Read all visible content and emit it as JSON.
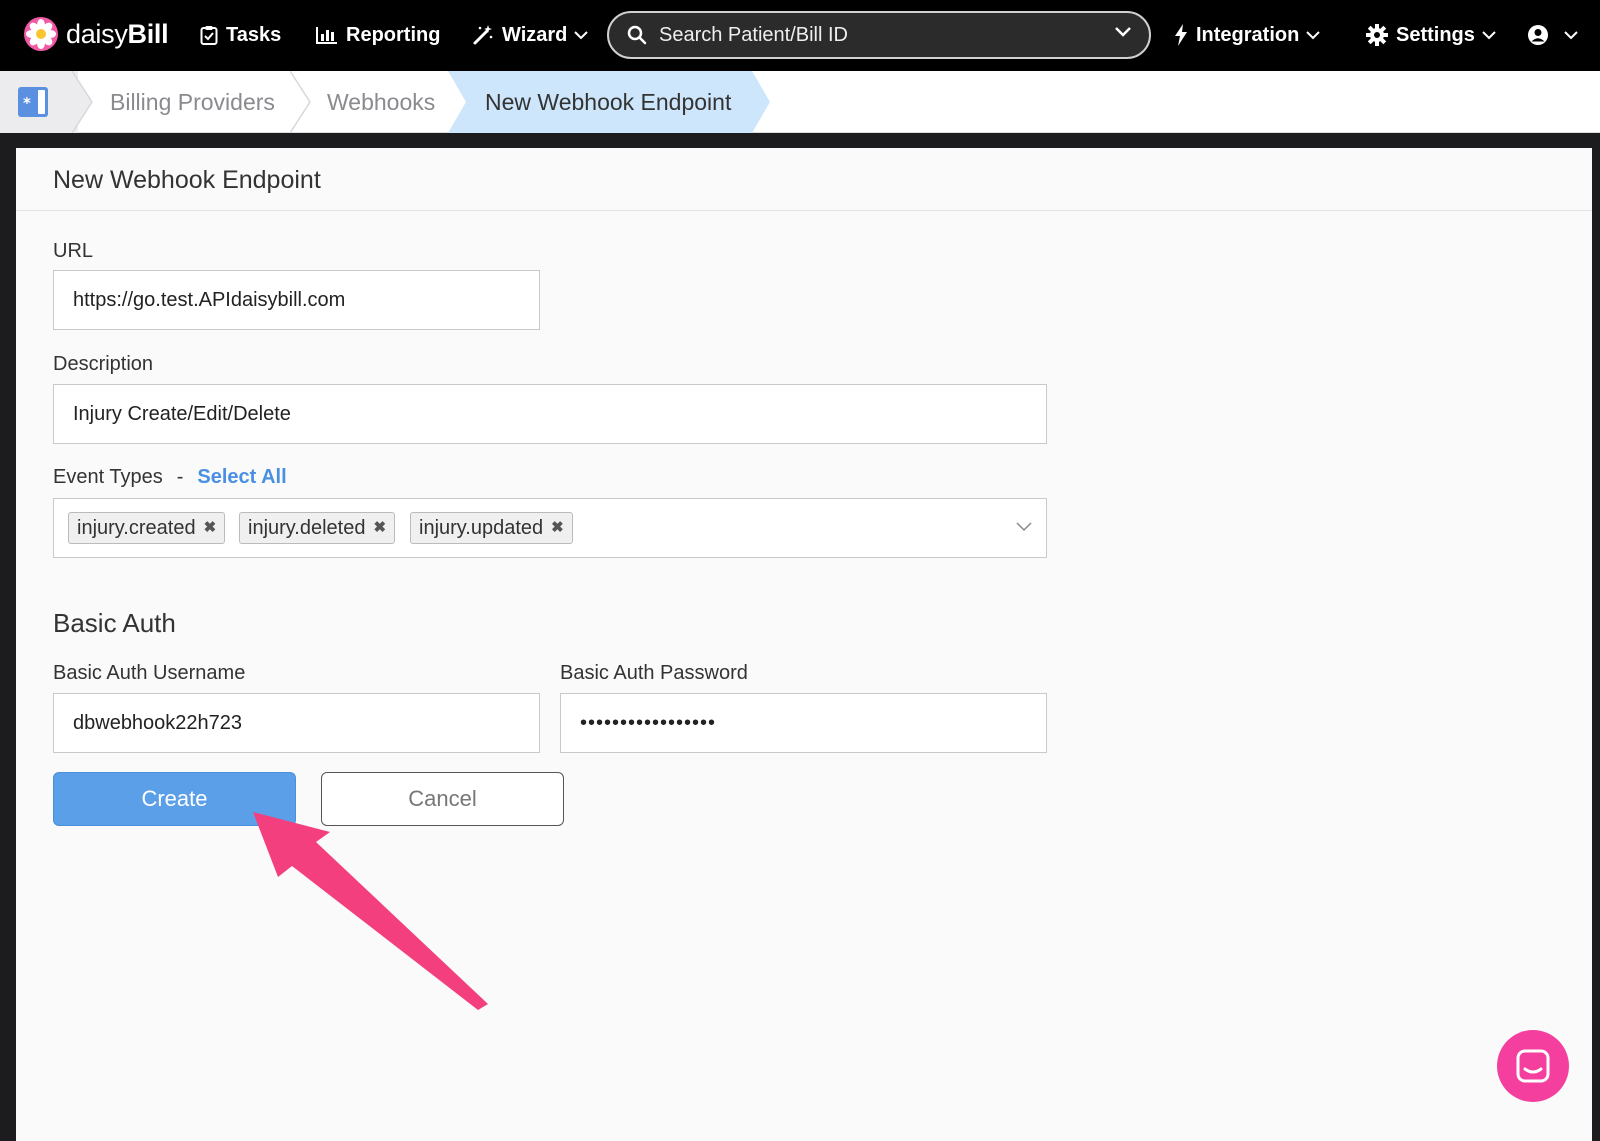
{
  "nav": {
    "logo_light": "daisy",
    "logo_bold": "Bill",
    "tasks": "Tasks",
    "reporting": "Reporting",
    "wizard": "Wizard",
    "search_placeholder": "Search Patient/Bill ID",
    "integration": "Integration",
    "settings": "Settings"
  },
  "breadcrumb": {
    "items": [
      "Billing Providers",
      "Webhooks"
    ],
    "current": "New Webhook Endpoint"
  },
  "form": {
    "title": "New Webhook Endpoint",
    "url_label": "URL",
    "url_value": "https://go.test.APIdaisybill.com",
    "description_label": "Description",
    "description_value": "Injury Create/Edit/Delete",
    "event_types_label": "Event Types",
    "event_types_sep": "-",
    "select_all": "Select All",
    "event_types": [
      "injury.created",
      "injury.deleted",
      "injury.updated"
    ],
    "basic_auth_title": "Basic Auth",
    "username_label": "Basic Auth Username",
    "username_value": "dbwebhook22h723",
    "password_label": "Basic Auth Password",
    "password_value": "•••••••••••••••••",
    "create_label": "Create",
    "cancel_label": "Cancel"
  },
  "colors": {
    "accent": "#5b9fe8",
    "annotation_arrow": "#f43f7e",
    "chat": "#f43f9e",
    "active_crumb": "#cde6fb"
  }
}
